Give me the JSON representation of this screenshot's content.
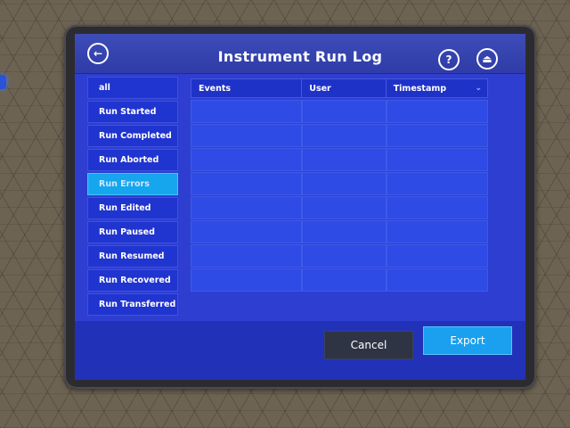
{
  "header": {
    "title": "Instrument Run Log",
    "back_icon": "arrow-left-icon",
    "help_icon": "question-icon",
    "eject_icon": "eject-icon"
  },
  "filters": [
    {
      "label": "all",
      "active": false
    },
    {
      "label": "Run Started",
      "active": false
    },
    {
      "label": "Run Completed",
      "active": false
    },
    {
      "label": "Run Aborted",
      "active": false
    },
    {
      "label": "Run Errors",
      "active": true
    },
    {
      "label": "Run Edited",
      "active": false
    },
    {
      "label": "Run Paused",
      "active": false
    },
    {
      "label": "Run Resumed",
      "active": false
    },
    {
      "label": "Run Recovered",
      "active": false
    },
    {
      "label": "Run Transferred",
      "active": false
    }
  ],
  "table": {
    "columns": [
      "Events",
      "User",
      "Timestamp"
    ],
    "sort_icon": "chevron-down-icon",
    "row_count": 8
  },
  "footer": {
    "cancel_label": "Cancel",
    "export_label": "Export"
  },
  "colors": {
    "screen": "#2e3ed0",
    "accent": "#1aa0ef"
  }
}
